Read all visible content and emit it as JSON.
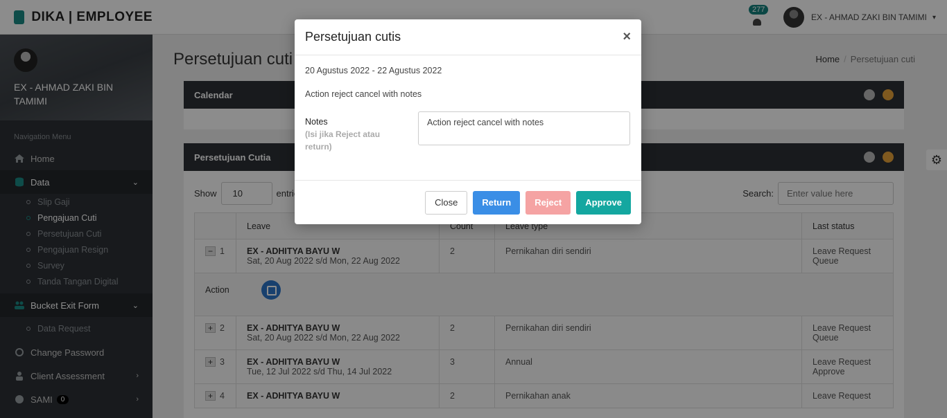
{
  "header": {
    "brand": "DIKA | EMPLOYEE",
    "notification_count": "277",
    "user_name": "EX - AHMAD ZAKI BIN TAMIMI",
    "caret": "▾"
  },
  "sidebar": {
    "profile_name": "EX - AHMAD ZAKI BIN TAMIMI",
    "nav_heading": "Navigation Menu",
    "home": "Home",
    "data": "Data",
    "data_items": [
      "Slip Gaji",
      "Pengajuan Cuti",
      "Persetujuan Cuti",
      "Pengajuan Resign",
      "Survey",
      "Tanda Tangan Digital"
    ],
    "bucket": "Bucket Exit Form",
    "bucket_items": [
      "Data Request"
    ],
    "change_password": "Change Password",
    "client_assessment": "Client Assessment",
    "sami": "SAMI",
    "sami_badge": "0"
  },
  "main": {
    "page_title": "Persetujuan cuti",
    "breadcrumb_home": "Home",
    "breadcrumb_current": "Persetujuan cuti",
    "calendar_title": "Calendar",
    "approval_title": "Persetujuan Cutia",
    "show_label": "Show",
    "show_value": "10",
    "entries_label": "entries",
    "search_label": "Search:",
    "search_placeholder": "Enter value here",
    "columns": [
      "Leave",
      "Count",
      "Leave type",
      "Last status"
    ],
    "action_label": "Action",
    "rows": [
      {
        "toggle": "−",
        "no": "1",
        "name": "EX - ADHITYA BAYU W",
        "dates": "Sat, 20 Aug 2022 s/d Mon, 22 Aug 2022",
        "count": "2",
        "type": "Pernikahan diri sendiri",
        "status": "Leave Request Queue"
      },
      {
        "toggle": "+",
        "no": "2",
        "name": "EX - ADHITYA BAYU W",
        "dates": "Sat, 20 Aug 2022 s/d Mon, 22 Aug 2022",
        "count": "2",
        "type": "Pernikahan diri sendiri",
        "status": "Leave Request Queue"
      },
      {
        "toggle": "+",
        "no": "3",
        "name": "EX - ADHITYA BAYU W",
        "dates": "Tue, 12 Jul 2022 s/d Thu, 14 Jul 2022",
        "count": "3",
        "type": "Annual",
        "status": "Leave Request Approve"
      },
      {
        "toggle": "+",
        "no": "4",
        "name": "EX - ADHITYA BAYU W",
        "dates": "",
        "count": "2",
        "type": "Pernikahan anak",
        "status": "Leave Request"
      }
    ]
  },
  "modal": {
    "title": "Persetujuan cutis",
    "close_symbol": "×",
    "date_range": "20 Agustus 2022 - 22 Agustus 2022",
    "action_text": "Action reject cancel with notes",
    "notes_label": "Notes",
    "notes_hint": "(Isi jika Reject atau return)",
    "notes_value": "Action reject cancel with notes",
    "buttons": {
      "close": "Close",
      "return": "Return",
      "reject": "Reject",
      "approve": "Approve"
    }
  },
  "colors": {
    "accent": "#14a7a0",
    "return": "#3a8ee6",
    "reject": "#f5a3a3",
    "sidebar": "#2c3136"
  }
}
